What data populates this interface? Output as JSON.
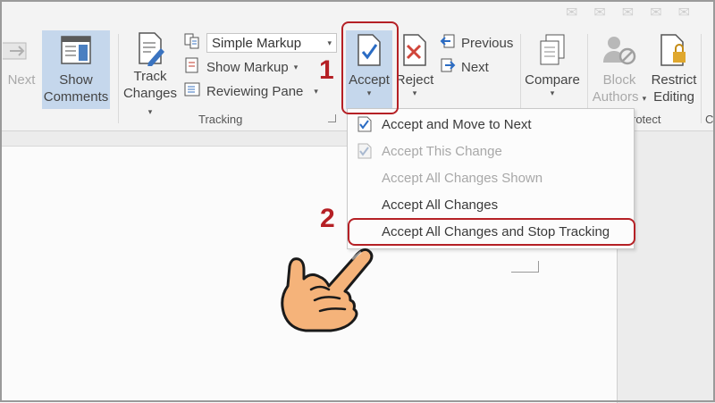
{
  "ribbon": {
    "next_left": {
      "label": "Next"
    },
    "show_comments": {
      "line1": "Show",
      "line2": "Comments"
    },
    "track_changes": {
      "line1": "Track",
      "line2": "Changes"
    },
    "markup_combo": {
      "value": "Simple Markup"
    },
    "show_markup": {
      "label": "Show Markup"
    },
    "reviewing_pane": {
      "label": "Reviewing Pane"
    },
    "tracking_group": "Tracking",
    "accept": {
      "label": "Accept"
    },
    "reject": {
      "label": "Reject"
    },
    "previous": {
      "label": "Previous"
    },
    "next": {
      "label": "Next"
    },
    "compare": {
      "label": "Compare"
    },
    "block_authors": {
      "line1": "Block",
      "line2": "Authors"
    },
    "restrict_editing": {
      "line1": "Restrict",
      "line2": "Editing"
    },
    "protect_group": "rotect",
    "partial_group": "C"
  },
  "accept_menu": {
    "items": [
      {
        "label": "Accept and Move to Next",
        "mnemonic": "M",
        "enabled": true
      },
      {
        "label": "Accept This Change",
        "mnemonic": "c",
        "enabled": false
      },
      {
        "label": "Accept All Changes Shown",
        "mnemonic": "A",
        "enabled": false
      },
      {
        "label": "Accept All Changes",
        "mnemonic": "l",
        "enabled": true
      },
      {
        "label": "Accept All Changes and Stop Tracking",
        "mnemonic": "S",
        "enabled": true
      }
    ]
  },
  "annotations": {
    "step1": "1",
    "step2": "2"
  },
  "colors": {
    "accent_red": "#b52025",
    "selected_blue": "#c5d7ec",
    "check_blue": "#2b6cc4"
  }
}
